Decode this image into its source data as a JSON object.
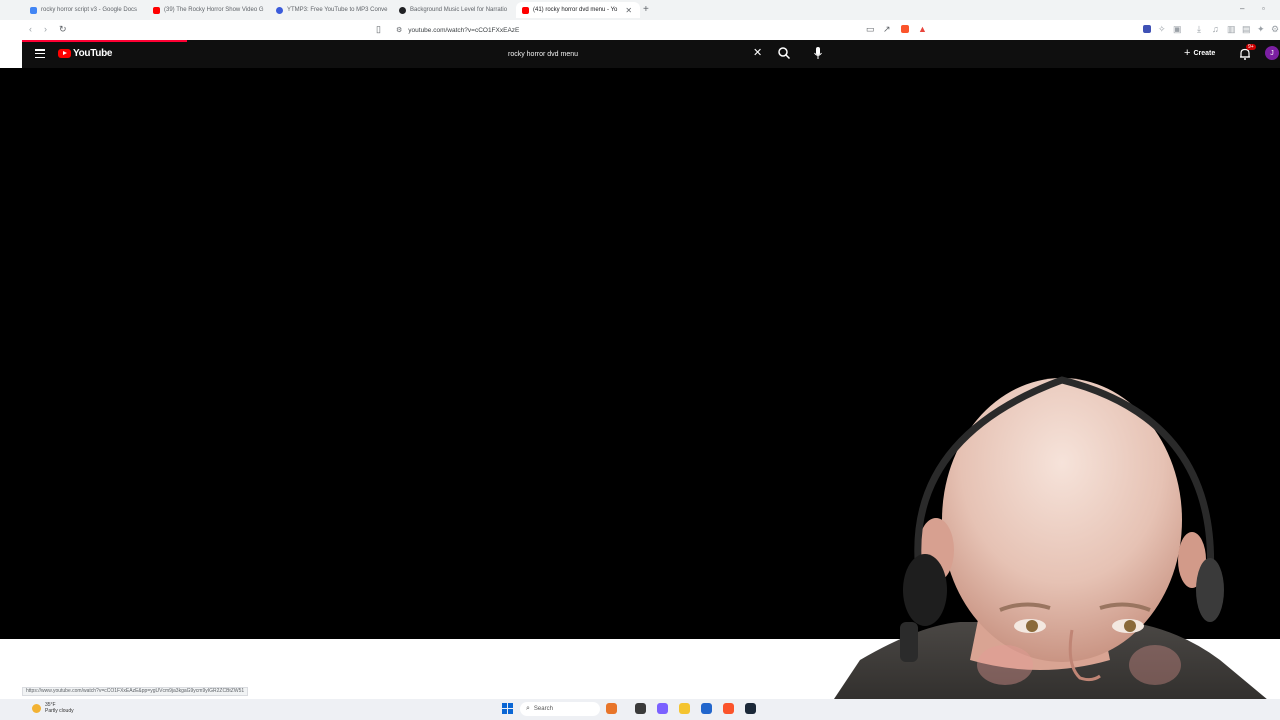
{
  "browser": {
    "tabs": [
      {
        "label": "rocky horror script v3 - Google Docs",
        "favicon_color": "#4285f4",
        "active": false
      },
      {
        "label": "(39) The Rocky Horror Show Video G",
        "favicon_color": "#ff0000",
        "active": false
      },
      {
        "label": "YTMP3: Free YouTube to MP3 Conve",
        "favicon_color": "#3b5bdb",
        "active": false
      },
      {
        "label": "Background Music Level for Narratio",
        "favicon_color": "#202124",
        "active": false
      },
      {
        "label": "(41) rocky horror dvd menu - Yo",
        "favicon_color": "#ff0000",
        "active": true
      }
    ],
    "new_tab_icon": "plus-icon",
    "address_url": "youtube.com/watch?v=cCO1FXxEAzE",
    "status_url": "https://www.youtube.com/watch?v=cCO1FXxEAzE&pp=ygUVcm9ja3kgaG9ycm9yIGR2ZCBtZW51"
  },
  "youtube": {
    "logo_text": "YouTube",
    "search_value": "rocky horror dvd menu",
    "create_label": "Create",
    "notification_badge": "9+",
    "avatar_letter": "J",
    "brand_color": "#ff0000",
    "header_bg": "#0f0f0f"
  },
  "taskbar": {
    "weather_temp": "35°F",
    "weather_desc": "Partly cloudy",
    "search_label": "Search"
  }
}
